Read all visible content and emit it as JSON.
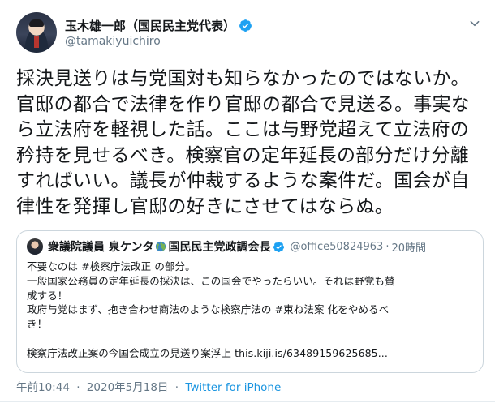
{
  "author": {
    "display_name": "玉木雄一郎（国民民主党代表）",
    "handle": "@tamakiyuichiro"
  },
  "tweet": {
    "lines": [
      "採決見送りは与党国対も知らなかったのではないか。",
      "官邸の都合で法律を作り官邸の都合で見送る。事実な",
      "ら立法府を軽視した話。ここは与野党超えて立法府の",
      "矜持を見せるべき。検察官の定年延長の部分だけ分離",
      "すればいい。議長が仲裁するような案件だ。国会が自",
      "律性を発揮し官邸の好きにさせてはならぬ。"
    ]
  },
  "quote": {
    "name": "衆議院議員 泉ケンタ",
    "title": "国民民主党政調会長",
    "handle": "@office50824963",
    "dot": "·",
    "time": "20時間",
    "lines": [
      "不要なのは #検察庁法改正 の部分。",
      "一般国家公務員の定年延長の採決は、この国会でやったらいい。それは野党も賛",
      "成する！",
      "政府与党はまず、抱き合わせ商法のような検察庁法の #束ね法案 化をやめるべ",
      "き！",
      "",
      "検察庁法改正案の今国会成立の見送り案浮上  this.kiji.is/63489159625685..."
    ]
  },
  "footer": {
    "time": "午前10:44",
    "sep": "·",
    "date": "2020年5月18日",
    "sep2": "·",
    "source": "Twitter for iPhone"
  },
  "colors": {
    "verified": "#1da1f2",
    "link": "#1b95e0",
    "muted": "#657786",
    "border": "#ccd6dd"
  },
  "icons": {
    "verified": "verified-badge-icon",
    "menu": "chevron-down-icon",
    "earth": "earth-globe-icon"
  }
}
